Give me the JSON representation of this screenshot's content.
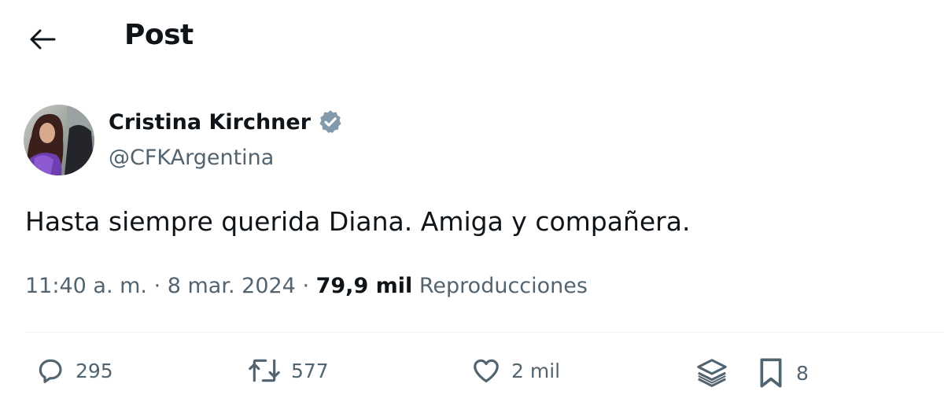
{
  "header": {
    "title": "Post",
    "back_icon": "arrow-left-icon"
  },
  "author": {
    "display_name": "Cristina Kirchner",
    "handle": "@CFKArgentina",
    "verified": true,
    "verified_color": "#829aab",
    "avatar_icon": "profile-photo"
  },
  "post": {
    "text": "Hasta siempre querida Diana. Amiga y compañera."
  },
  "meta": {
    "time": "11:40 a. m.",
    "separator": " · ",
    "date": "8 mar. 2024",
    "views_count": "79,9 mil",
    "views_label": "Reproducciones"
  },
  "actions": {
    "replies": "295",
    "reposts": "577",
    "likes": "2 mil",
    "bookmarks": "8"
  },
  "colors": {
    "text_primary": "#0f1419",
    "text_secondary": "#536471",
    "divider": "#eff3f4"
  }
}
